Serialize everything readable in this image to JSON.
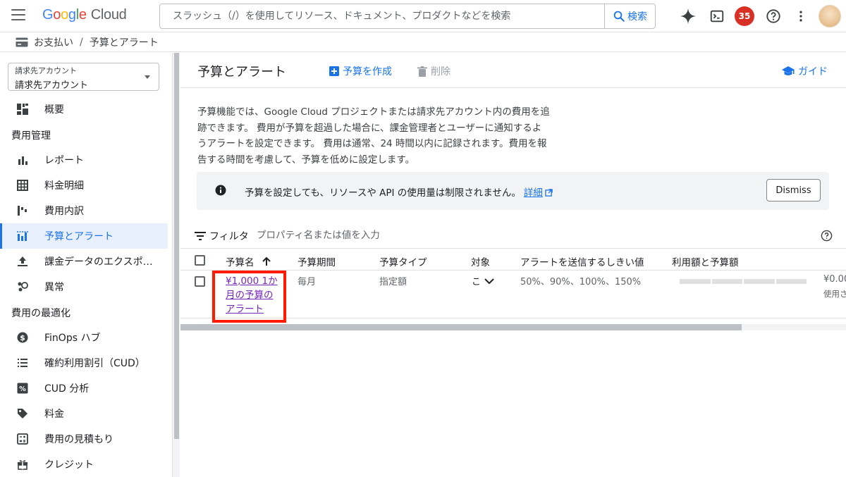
{
  "topbar": {
    "logo_google": "Google",
    "logo_cloud": "Cloud",
    "search_placeholder": "スラッシュ（/）を使用してリソース、ドキュメント、プロダクトなどを検索",
    "search_button": "検索",
    "notification_count": "35",
    "icons": [
      "menu-icon",
      "gemini-spark-icon",
      "cloud-shell-icon",
      "help-icon",
      "more-vert-icon"
    ]
  },
  "breadcrumb": {
    "root": "お支払い",
    "separator": "/",
    "current": "予算とアラート"
  },
  "sidebar": {
    "account_label": "請求先アカウント",
    "account_value": "請求先アカウント",
    "overview": "概要",
    "section_cost_management": "費用管理",
    "reports": "レポート",
    "cost_table": "料金明細",
    "cost_breakdown": "費用内訳",
    "budgets_alerts": "予算とアラート",
    "billing_export": "課金データのエクスポ…",
    "anomalies": "異常",
    "section_optimization": "費用の最適化",
    "finops_hub": "FinOps ハブ",
    "cud": "確約利用割引（CUD）",
    "cud_analysis": "CUD 分析",
    "pricing": "料金",
    "estimate": "費用の見積もり",
    "credits": "クレジット"
  },
  "main": {
    "title": "予算とアラート",
    "create_budget": "予算を作成",
    "delete": "削除",
    "guide": "ガイド",
    "description_lines": [
      "予算機能では、Google Cloud プロジェクトまたは請求先アカウント内の費用を追",
      "跡できます。 費用が予算を超過した場合に、課金管理者とユーザーに通知するよ",
      "うアラートを設定できます。 費用は通常、24 時間以内に記録されます。費用を報",
      "告する時間を考慮して、予算を低めに設定します。"
    ],
    "info_message": "予算を設定しても、リソースや API の使用量は制限されません。",
    "info_link": "詳細",
    "dismiss": "Dismiss",
    "filter_label": "フィルタ",
    "filter_placeholder": "プロパティ名または値を入力"
  },
  "table": {
    "columns": {
      "name": "予算名",
      "period": "予算期間",
      "type": "予算タイプ",
      "target": "対象",
      "thresholds": "アラートを送信するしきい値",
      "usage": "利用額と予算額"
    },
    "rows": [
      {
        "name": "¥1,000 1か月の予算のアラート",
        "period": "毎月",
        "type": "指定額",
        "target": "こ",
        "thresholds": "50%、90%、100%、150%",
        "amount": "¥0.00",
        "amount_sub": "使用さ"
      }
    ]
  },
  "colors": {
    "accent": "#1a73e8",
    "visited_link": "#7627bb",
    "highlight": "#ff1a00",
    "badge": "#d93025"
  }
}
